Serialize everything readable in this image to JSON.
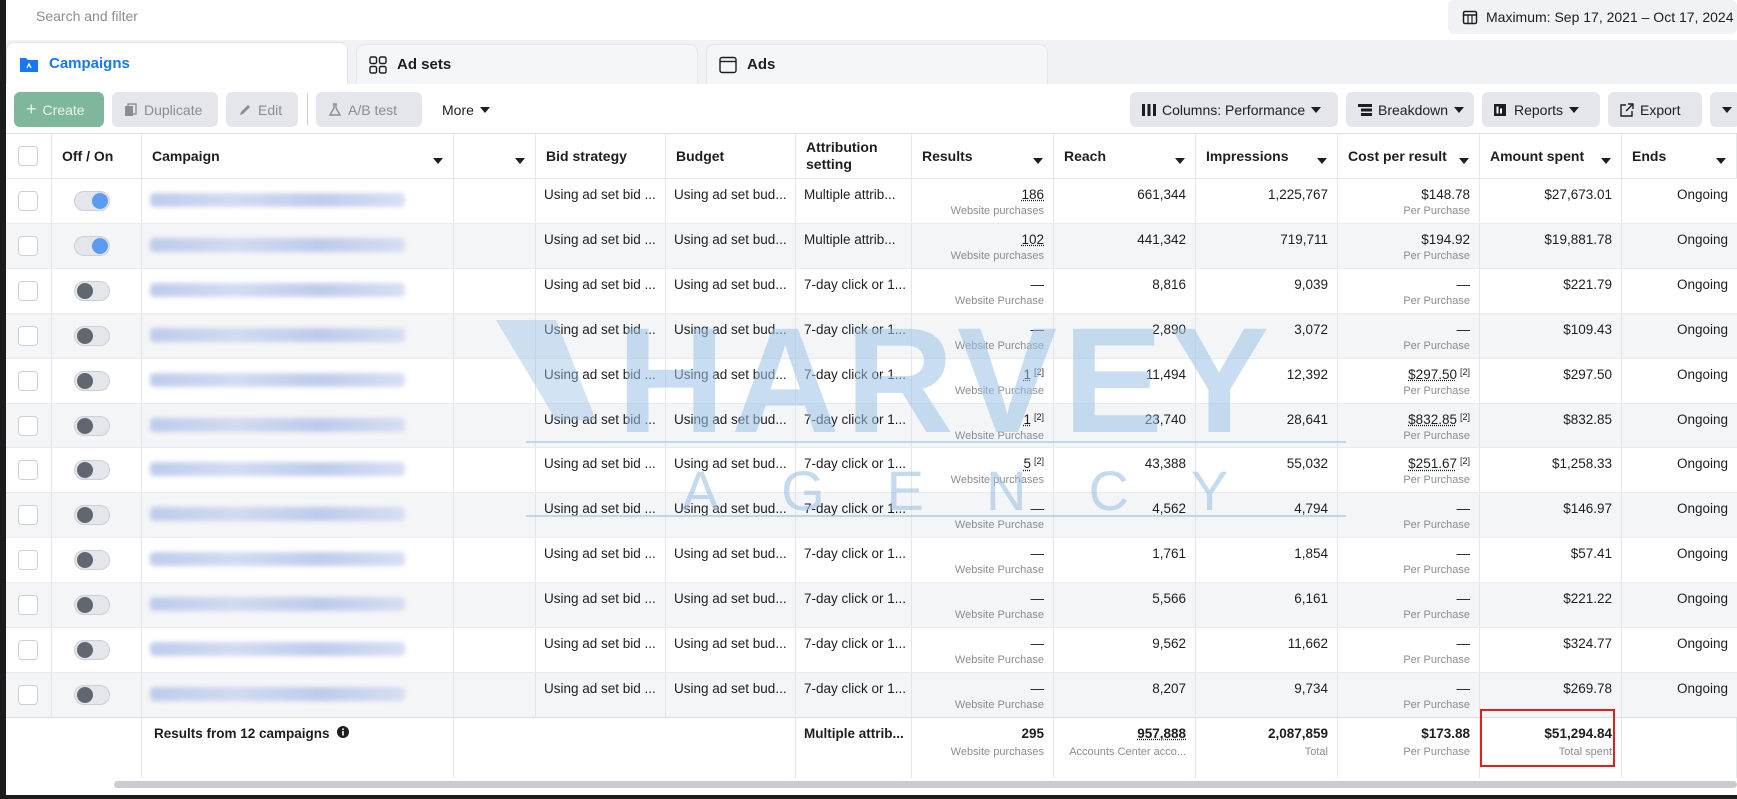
{
  "search": {
    "placeholder": "Search and filter"
  },
  "date_range": "Maximum: Sep 17, 2021 – Oct 17, 2024",
  "tabs": [
    {
      "label": "Campaigns",
      "icon": "folder-icon"
    },
    {
      "label": "Ad sets",
      "icon": "grid-icon"
    },
    {
      "label": "Ads",
      "icon": "ad-icon"
    }
  ],
  "toolbar": {
    "create": "Create",
    "duplicate": "Duplicate",
    "edit": "Edit",
    "ab_test": "A/B test",
    "more": "More",
    "columns": "Columns: Performance",
    "breakdown": "Breakdown",
    "reports": "Reports",
    "export": "Export"
  },
  "headers": {
    "off_on": "Off / On",
    "campaign": "Campaign",
    "bid_strategy": "Bid strategy",
    "budget": "Budget",
    "attribution_line1": "Attribution",
    "attribution_line2": "setting",
    "results": "Results",
    "reach": "Reach",
    "impressions": "Impressions",
    "cost_per_result": "Cost per result",
    "amount_spent": "Amount spent",
    "ends": "Ends"
  },
  "rows": [
    {
      "on": true,
      "bid": "Using ad set bid ...",
      "budget": "Using ad set bud...",
      "attr": "Multiple attrib...",
      "results": "186",
      "results_note": "",
      "results_sub": "Website purchases",
      "reach": "661,344",
      "impressions": "1,225,767",
      "cpr": "$148.78",
      "cpr_note": "",
      "cpr_sub": "Per Purchase",
      "spent": "$27,673.01",
      "ends": "Ongoing"
    },
    {
      "on": true,
      "bid": "Using ad set bid ...",
      "budget": "Using ad set bud...",
      "attr": "Multiple attrib...",
      "results": "102",
      "results_note": "",
      "results_sub": "Website purchases",
      "reach": "441,342",
      "impressions": "719,711",
      "cpr": "$194.92",
      "cpr_note": "",
      "cpr_sub": "Per Purchase",
      "spent": "$19,881.78",
      "ends": "Ongoing"
    },
    {
      "on": false,
      "bid": "Using ad set bid ...",
      "budget": "Using ad set bud...",
      "attr": "7-day click or 1...",
      "results": "—",
      "results_note": "",
      "results_sub": "Website Purchase",
      "reach": "8,816",
      "impressions": "9,039",
      "cpr": "—",
      "cpr_note": "",
      "cpr_sub": "Per Purchase",
      "spent": "$221.79",
      "ends": "Ongoing"
    },
    {
      "on": false,
      "bid": "Using ad set bid ...",
      "budget": "Using ad set bud...",
      "attr": "7-day click or 1...",
      "results": "—",
      "results_note": "",
      "results_sub": "Website Purchase",
      "reach": "2,890",
      "impressions": "3,072",
      "cpr": "—",
      "cpr_note": "",
      "cpr_sub": "Per Purchase",
      "spent": "$109.43",
      "ends": "Ongoing"
    },
    {
      "on": false,
      "bid": "Using ad set bid ...",
      "budget": "Using ad set bud...",
      "attr": "7-day click or 1...",
      "results": "1",
      "results_note": "[2]",
      "results_sub": "Website Purchase",
      "reach": "11,494",
      "impressions": "12,392",
      "cpr": "$297.50",
      "cpr_note": "[2]",
      "cpr_sub": "Per Purchase",
      "spent": "$297.50",
      "ends": "Ongoing"
    },
    {
      "on": false,
      "bid": "Using ad set bid ...",
      "budget": "Using ad set bud...",
      "attr": "7-day click or 1...",
      "results": "1",
      "results_note": "[2]",
      "results_sub": "Website Purchase",
      "reach": "23,740",
      "impressions": "28,641",
      "cpr": "$832.85",
      "cpr_note": "[2]",
      "cpr_sub": "Per Purchase",
      "spent": "$832.85",
      "ends": "Ongoing"
    },
    {
      "on": false,
      "bid": "Using ad set bid ...",
      "budget": "Using ad set bud...",
      "attr": "7-day click or 1...",
      "results": "5",
      "results_note": "[2]",
      "results_sub": "Website purchases",
      "reach": "43,388",
      "impressions": "55,032",
      "cpr": "$251.67",
      "cpr_note": "[2]",
      "cpr_sub": "Per Purchase",
      "spent": "$1,258.33",
      "ends": "Ongoing"
    },
    {
      "on": false,
      "bid": "Using ad set bid ...",
      "budget": "Using ad set bud...",
      "attr": "7-day click or 1...",
      "results": "—",
      "results_note": "",
      "results_sub": "Website Purchase",
      "reach": "4,562",
      "impressions": "4,794",
      "cpr": "—",
      "cpr_note": "",
      "cpr_sub": "Per Purchase",
      "spent": "$146.97",
      "ends": "Ongoing"
    },
    {
      "on": false,
      "bid": "Using ad set bid ...",
      "budget": "Using ad set bud...",
      "attr": "7-day click or 1...",
      "results": "—",
      "results_note": "",
      "results_sub": "Website Purchase",
      "reach": "1,761",
      "impressions": "1,854",
      "cpr": "—",
      "cpr_note": "",
      "cpr_sub": "Per Purchase",
      "spent": "$57.41",
      "ends": "Ongoing"
    },
    {
      "on": false,
      "bid": "Using ad set bid ...",
      "budget": "Using ad set bud...",
      "attr": "7-day click or 1...",
      "results": "—",
      "results_note": "",
      "results_sub": "Website Purchase",
      "reach": "5,566",
      "impressions": "6,161",
      "cpr": "—",
      "cpr_note": "",
      "cpr_sub": "Per Purchase",
      "spent": "$221.22",
      "ends": "Ongoing"
    },
    {
      "on": false,
      "bid": "Using ad set bid ...",
      "budget": "Using ad set bud...",
      "attr": "7-day click or 1...",
      "results": "—",
      "results_note": "",
      "results_sub": "Website Purchase",
      "reach": "9,562",
      "impressions": "11,662",
      "cpr": "—",
      "cpr_note": "",
      "cpr_sub": "Per Purchase",
      "spent": "$324.77",
      "ends": "Ongoing"
    },
    {
      "on": false,
      "bid": "Using ad set bid ...",
      "budget": "Using ad set bud...",
      "attr": "7-day click or 1...",
      "results": "—",
      "results_note": "",
      "results_sub": "Website Purchase",
      "reach": "8,207",
      "impressions": "9,734",
      "cpr": "—",
      "cpr_note": "",
      "cpr_sub": "Per Purchase",
      "spent": "$269.78",
      "ends": "Ongoing"
    }
  ],
  "footer": {
    "label": "Results from 12 campaigns",
    "attr": "Multiple attrib...",
    "results": "295",
    "results_sub": "Website purchases",
    "reach": "957,888",
    "reach_sub": "Accounts Center acco...",
    "impressions": "2,087,859",
    "impressions_sub": "Total",
    "cpr": "$173.88",
    "cpr_sub": "Per Purchase",
    "spent": "$51,294.84",
    "spent_sub": "Total spent"
  },
  "watermark": {
    "main": "HARVEY",
    "sub": "AGENCY"
  },
  "colors": {
    "accent": "#1877f2",
    "create": "#7fb79c",
    "highlight": "#e02020",
    "watermark": "#9cc3e6"
  }
}
